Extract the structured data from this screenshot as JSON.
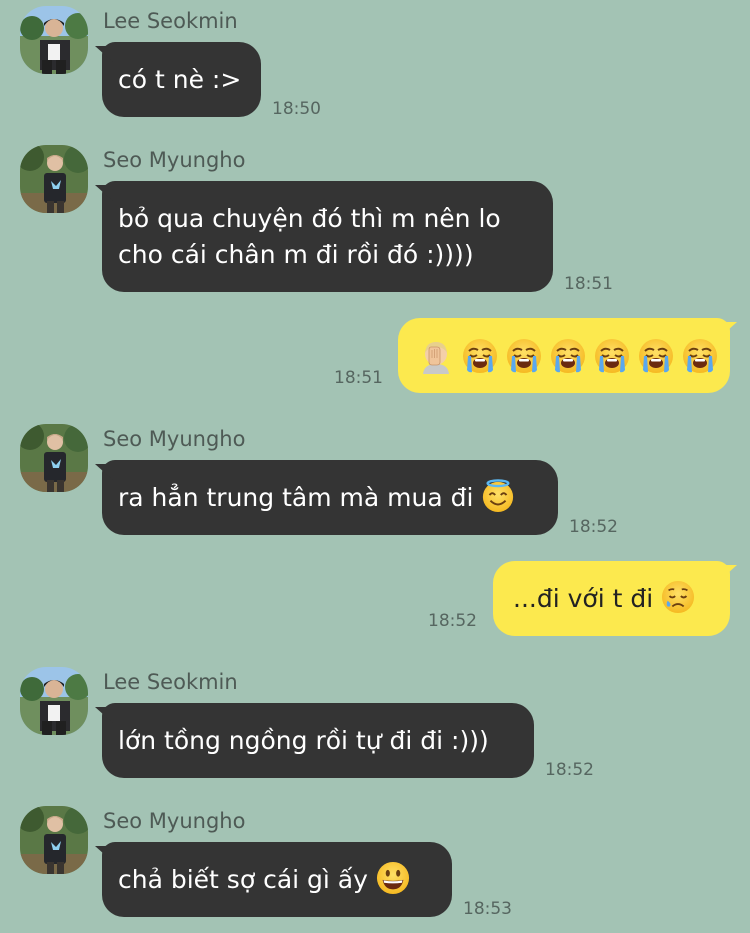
{
  "messages": [
    {
      "sender": "Lee Seokmin",
      "lines": [
        "có t nè :>"
      ],
      "time": "18:50"
    },
    {
      "sender": "Seo Myungho",
      "lines": [
        "bỏ qua chuyện đó thì m nên lo",
        "cho cái chân m đi rồi đó :))))"
      ],
      "time": "18:51"
    },
    {
      "emojis": [
        "facepalm-emoji",
        "loudly-crying-face-emoji",
        "loudly-crying-face-emoji",
        "loudly-crying-face-emoji",
        "loudly-crying-face-emoji",
        "loudly-crying-face-emoji",
        "loudly-crying-face-emoji"
      ],
      "time": "18:51"
    },
    {
      "sender": "Seo Myungho",
      "text": "ra hẳn trung tâm mà mua đi",
      "emoji": "smiling-face-with-halo-emoji",
      "time": "18:52"
    },
    {
      "text": "...đi với t đi",
      "emoji": "sad-but-relieved-face-emoji",
      "time": "18:52"
    },
    {
      "sender": "Lee Seokmin",
      "lines": [
        "lớn tồng ngồng rồi tự đi đi :)))"
      ],
      "time": "18:52"
    },
    {
      "sender": "Seo Myungho",
      "text": "chả biết sợ cái gì ấy",
      "emoji": "grinning-face-with-big-eyes-emoji",
      "time": "18:53"
    }
  ],
  "colors": {
    "background": "#a3c3b4",
    "incoming_bubble": "#343434",
    "outgoing_bubble": "#fce94e"
  }
}
